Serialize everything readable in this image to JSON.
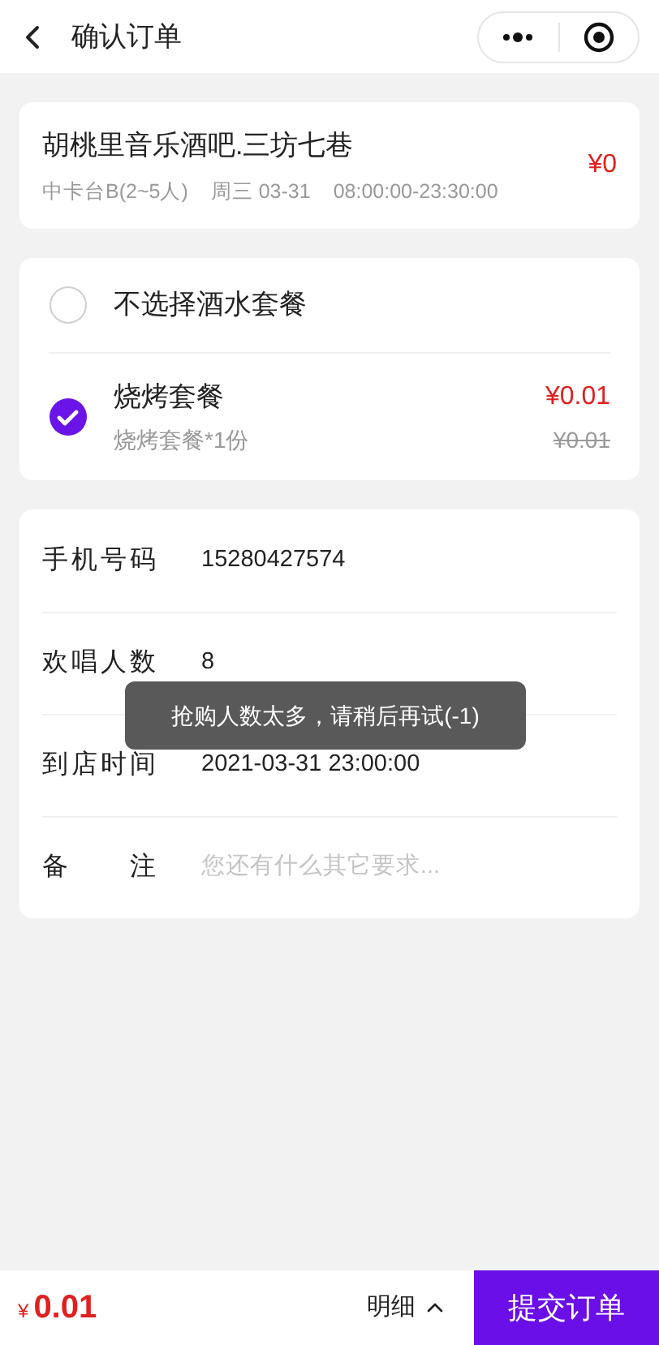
{
  "header": {
    "title": "确认订单"
  },
  "venue": {
    "name": "胡桃里音乐酒吧.三坊七巷",
    "table": "中卡台B(2~5人)",
    "day": "周三 03-31",
    "hours": "08:00:00-23:30:00",
    "price": "¥0"
  },
  "packages": [
    {
      "name": "不选择酒水套餐",
      "selected": false
    },
    {
      "name": "烧烤套餐",
      "selected": true,
      "detail": "烧烤套餐*1份",
      "price": "¥0.01",
      "original_price": "¥0.01"
    }
  ],
  "fields": [
    {
      "kind": "value",
      "label": "手机号码",
      "value": "15280427574"
    },
    {
      "kind": "value",
      "label": "欢唱人数",
      "value": "8"
    },
    {
      "kind": "value",
      "label": "到店时间",
      "value": "2021-03-31 23:00:00"
    },
    {
      "kind": "input",
      "label": "备　　注",
      "placeholder": "您还有什么其它要求..."
    }
  ],
  "toast": "抢购人数太多，请稍后再试(-1)",
  "footer": {
    "currency": "¥",
    "total": "0.01",
    "details": "明细",
    "submit": "提交订单"
  }
}
